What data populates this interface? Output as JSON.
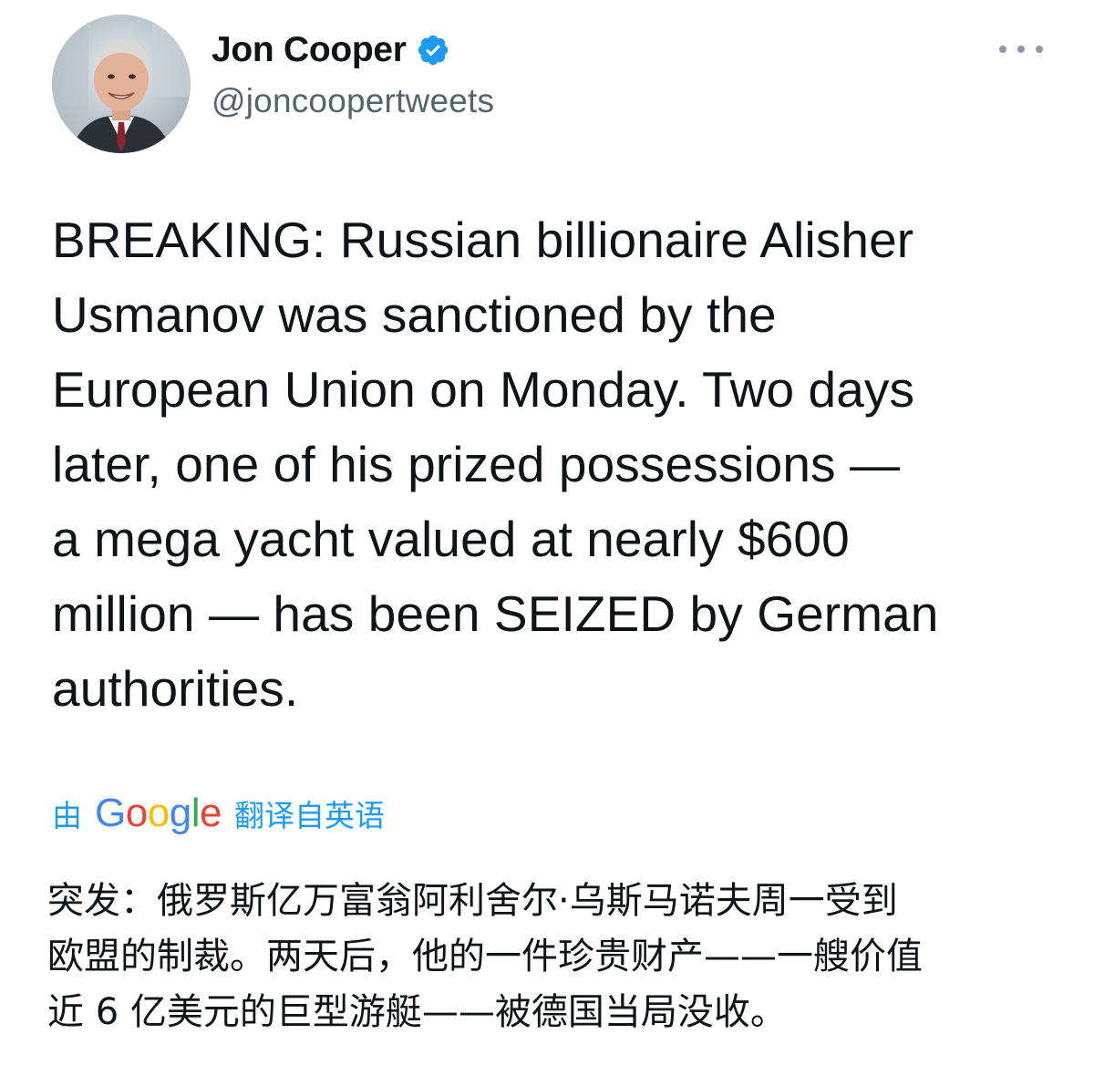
{
  "author": {
    "display_name": "Jon Cooper",
    "handle": "@joncoopertweets",
    "verified": true
  },
  "tweet": {
    "text": "BREAKING: Russian billionaire Alisher\nUsmanov was sanctioned by the\nEuropean Union on Monday. Two days\nlater, one of his prized possessions —\na mega yacht valued at nearly $600\nmillion — has been SEIZED by German\nauthorities."
  },
  "translation": {
    "prefix": "由",
    "brand": "Google",
    "suffix": "翻译自英语",
    "lines": [
      "突发：俄罗斯亿万富翁阿利舍尔·乌斯马诺夫周一受到",
      "欧盟的制裁。两天后，他的一件珍贵财产——一艘价值",
      "近 6 亿美元的巨型游艇——被德国当局没收。"
    ]
  },
  "icons": {
    "verified": "verified-badge-icon",
    "more": "more-options-icon"
  },
  "colors": {
    "text_primary": "#0f1419",
    "text_secondary": "#536471",
    "accent": "#1d9bf0",
    "google_blue": "#4285F4",
    "google_red": "#EA4335",
    "google_yellow": "#FBBC05",
    "google_green": "#34A853"
  }
}
